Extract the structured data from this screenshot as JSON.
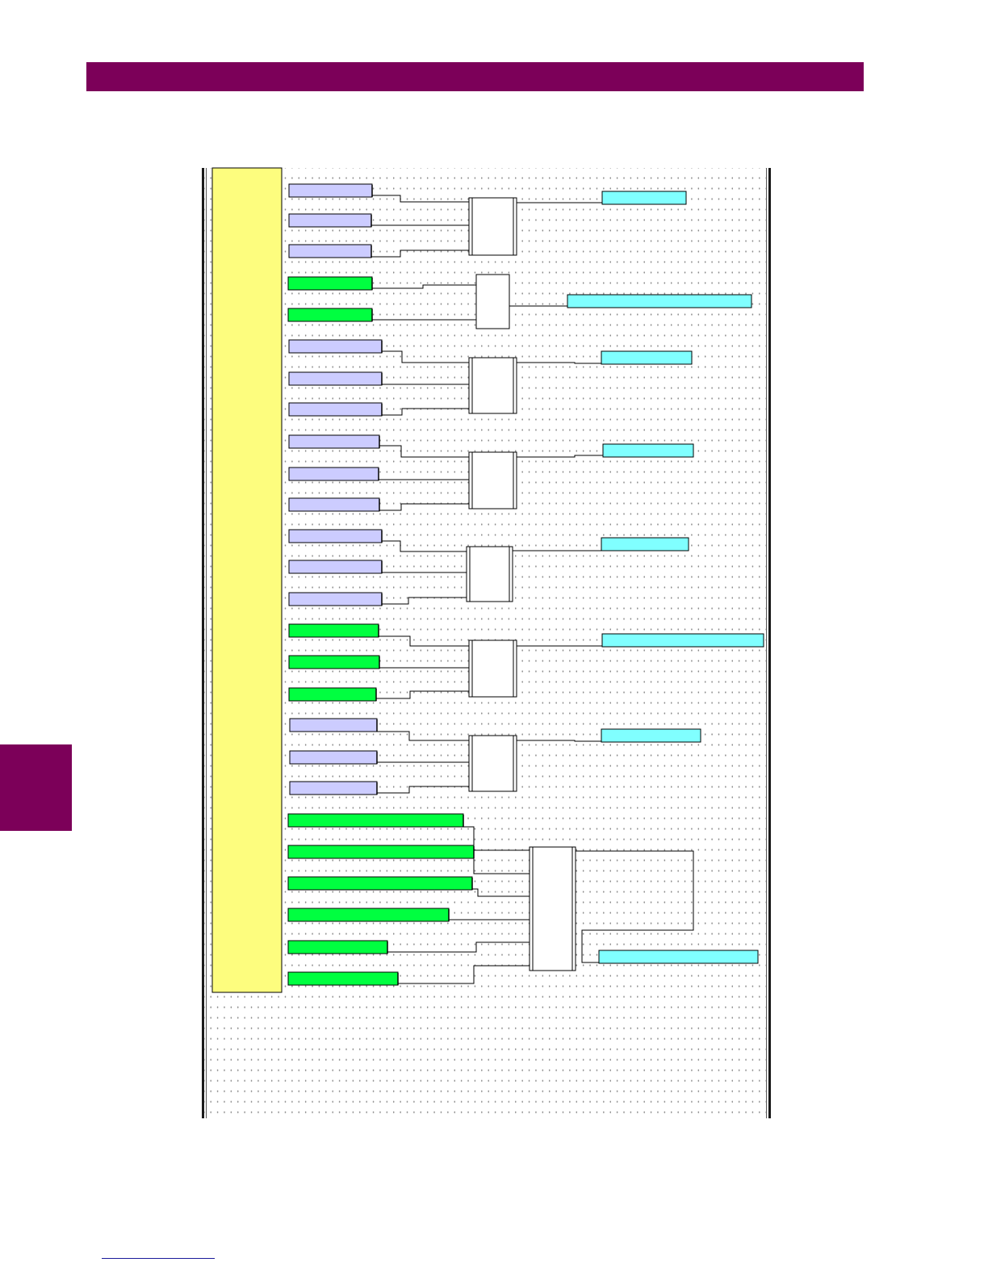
{
  "colors": {
    "brand": "#7c0059",
    "palette_column": "#fdfd7e",
    "input_operand": "#ccccff",
    "timer_operand": "#00ff40",
    "virtual_output": "#80ffff",
    "gate": "#ffffff",
    "wire": "#000000"
  },
  "header": {
    "title": ""
  },
  "diagram": {
    "gates": [
      {
        "id": "gate-1",
        "inputs": [
          "input",
          "input",
          "input"
        ],
        "output": "virtual-output"
      },
      {
        "id": "gate-2",
        "inputs": [
          "timer",
          "timer"
        ],
        "output": "virtual-output-wide"
      },
      {
        "id": "gate-3",
        "inputs": [
          "input",
          "input",
          "input"
        ],
        "output": "virtual-output"
      },
      {
        "id": "gate-4",
        "inputs": [
          "input",
          "input",
          "input"
        ],
        "output": "virtual-output"
      },
      {
        "id": "gate-5",
        "inputs": [
          "input",
          "input",
          "input"
        ],
        "output": "virtual-output"
      },
      {
        "id": "gate-6",
        "inputs": [
          "timer",
          "timer",
          "timer"
        ],
        "output": "virtual-output-wide"
      },
      {
        "id": "gate-7",
        "inputs": [
          "input",
          "input",
          "input"
        ],
        "output": "virtual-output"
      },
      {
        "id": "gate-8",
        "inputs": [
          "timer",
          "timer",
          "timer",
          "timer",
          "timer",
          "timer"
        ],
        "output": "virtual-output-wide"
      }
    ]
  }
}
